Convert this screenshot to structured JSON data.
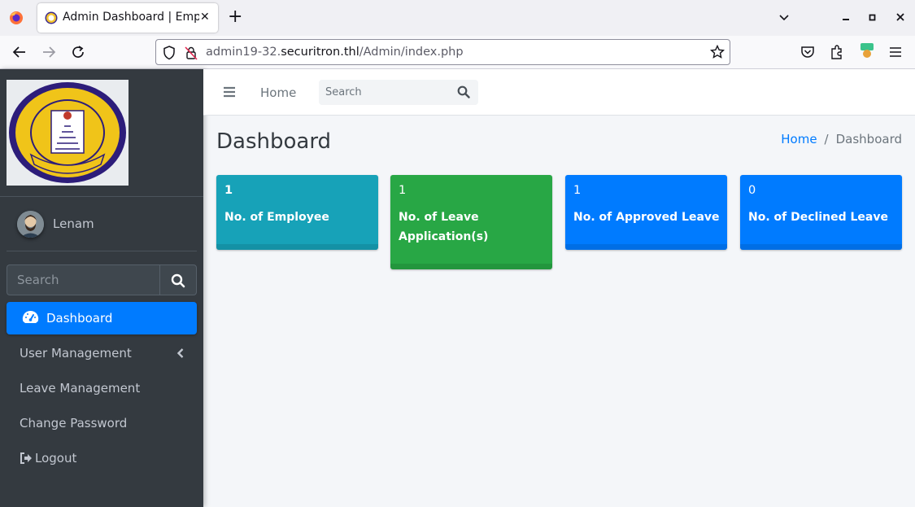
{
  "browser": {
    "tab_title": "Admin Dashboard | Empl",
    "tab_close": "✕",
    "new_tab": "+",
    "url_prefix": "admin19-32.",
    "url_domain": "securitron.thl",
    "url_path": "/Admin/index.php"
  },
  "sidebar": {
    "user_name": "Lenam",
    "search_placeholder": "Search",
    "items": [
      {
        "label": "Dashboard",
        "active": true
      },
      {
        "label": "User Management",
        "active": false
      },
      {
        "label": "Leave Management",
        "active": false
      },
      {
        "label": "Change Password",
        "active": false
      },
      {
        "label": "Logout",
        "active": false
      }
    ]
  },
  "header": {
    "home_label": "Home",
    "search_placeholder": "Search"
  },
  "content": {
    "title": "Dashboard",
    "breadcrumb": {
      "home": "Home",
      "separator": "/",
      "current": "Dashboard"
    },
    "boxes": [
      {
        "value": "1",
        "label": "No. of Employee",
        "color": "#17a2b8"
      },
      {
        "value": "1",
        "label": "No. of Leave Application(s)",
        "color": "#28a745"
      },
      {
        "value": "1",
        "label": "No. of Approved Leave",
        "color": "#007bff"
      },
      {
        "value": "0",
        "label": "No. of Declined Leave",
        "color": "#007bff"
      }
    ]
  },
  "colors": {
    "sidebar_bg": "#343a40",
    "accent": "#007bff",
    "info": "#17a2b8",
    "success": "#28a745"
  }
}
